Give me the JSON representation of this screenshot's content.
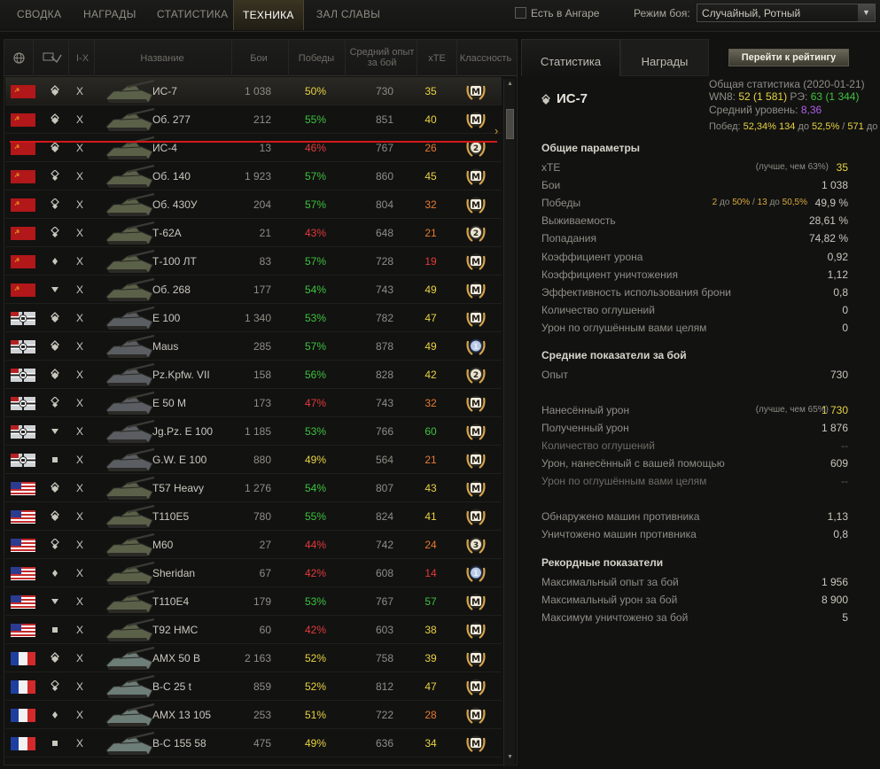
{
  "tabs": [
    "СВОДКА",
    "НАГРАДЫ",
    "СТАТИСТИКА",
    "ТЕХНИКА",
    "ЗАЛ СЛАВЫ"
  ],
  "hangar_label": "Есть в Ангаре",
  "mode_label": "Режим боя:",
  "mode_value": "Случайный, Ротный",
  "columns": {
    "tier": "I-X",
    "name": "Название",
    "battles": "Бои",
    "wins": "Победы",
    "avg_exp": "Средний опыт за бой",
    "xte": "хТЕ",
    "mastery": "Классность"
  },
  "rows": [
    {
      "nation": "ussr",
      "cls": "heavy",
      "tier": "X",
      "name": "ИС-7",
      "battles": "1 038",
      "wins": "50%",
      "wc": "y",
      "exp": "730",
      "xte": "35",
      "xc": "y",
      "mastery": "M",
      "sel": true
    },
    {
      "nation": "ussr",
      "cls": "heavy",
      "tier": "X",
      "name": "Об. 277",
      "battles": "212",
      "wins": "55%",
      "wc": "g",
      "exp": "851",
      "xte": "40",
      "xc": "y",
      "mastery": "M"
    },
    {
      "nation": "ussr",
      "cls": "heavy",
      "tier": "X",
      "name": "ИС-4",
      "battles": "13",
      "wins": "46%",
      "wc": "r",
      "exp": "767",
      "xte": "26",
      "xc": "o",
      "mastery": "2"
    },
    {
      "nation": "ussr",
      "cls": "medium",
      "tier": "X",
      "name": "Об. 140",
      "battles": "1 923",
      "wins": "57%",
      "wc": "g",
      "exp": "860",
      "xte": "45",
      "xc": "y",
      "mastery": "M"
    },
    {
      "nation": "ussr",
      "cls": "medium",
      "tier": "X",
      "name": "Об. 430У",
      "battles": "204",
      "wins": "57%",
      "wc": "g",
      "exp": "804",
      "xte": "32",
      "xc": "o",
      "mastery": "M"
    },
    {
      "nation": "ussr",
      "cls": "medium",
      "tier": "X",
      "name": "Т-62А",
      "battles": "21",
      "wins": "43%",
      "wc": "r",
      "exp": "648",
      "xte": "21",
      "xc": "o",
      "mastery": "2"
    },
    {
      "nation": "ussr",
      "cls": "light",
      "tier": "X",
      "name": "Т-100 ЛТ",
      "battles": "83",
      "wins": "57%",
      "wc": "g",
      "exp": "728",
      "xte": "19",
      "xc": "r",
      "mastery": "M"
    },
    {
      "nation": "ussr",
      "cls": "td",
      "tier": "X",
      "name": "Об. 268",
      "battles": "177",
      "wins": "54%",
      "wc": "g",
      "exp": "743",
      "xte": "49",
      "xc": "y",
      "mastery": "M"
    },
    {
      "nation": "germany",
      "cls": "heavy",
      "tier": "X",
      "name": "E 100",
      "battles": "1 340",
      "wins": "53%",
      "wc": "g",
      "exp": "782",
      "xte": "47",
      "xc": "y",
      "mastery": "M"
    },
    {
      "nation": "germany",
      "cls": "heavy",
      "tier": "X",
      "name": "Maus",
      "battles": "285",
      "wins": "57%",
      "wc": "g",
      "exp": "878",
      "xte": "49",
      "xc": "y",
      "mastery": "1"
    },
    {
      "nation": "germany",
      "cls": "heavy",
      "tier": "X",
      "name": "Pz.Kpfw. VII",
      "battles": "158",
      "wins": "56%",
      "wc": "g",
      "exp": "828",
      "xte": "42",
      "xc": "y",
      "mastery": "2"
    },
    {
      "nation": "germany",
      "cls": "medium",
      "tier": "X",
      "name": "E 50 M",
      "battles": "173",
      "wins": "47%",
      "wc": "r",
      "exp": "743",
      "xte": "32",
      "xc": "o",
      "mastery": "M"
    },
    {
      "nation": "germany",
      "cls": "td",
      "tier": "X",
      "name": "Jg.Pz. E 100",
      "battles": "1 185",
      "wins": "53%",
      "wc": "g",
      "exp": "766",
      "xte": "60",
      "xc": "g",
      "mastery": "M"
    },
    {
      "nation": "germany",
      "cls": "spg",
      "tier": "X",
      "name": "G.W. E 100",
      "battles": "880",
      "wins": "49%",
      "wc": "y",
      "exp": "564",
      "xte": "21",
      "xc": "o",
      "mastery": "M"
    },
    {
      "nation": "usa",
      "cls": "heavy",
      "tier": "X",
      "name": "T57 Heavy",
      "battles": "1 276",
      "wins": "54%",
      "wc": "g",
      "exp": "807",
      "xte": "43",
      "xc": "y",
      "mastery": "M"
    },
    {
      "nation": "usa",
      "cls": "heavy",
      "tier": "X",
      "name": "T110E5",
      "battles": "780",
      "wins": "55%",
      "wc": "g",
      "exp": "824",
      "xte": "41",
      "xc": "y",
      "mastery": "M"
    },
    {
      "nation": "usa",
      "cls": "medium",
      "tier": "X",
      "name": "M60",
      "battles": "27",
      "wins": "44%",
      "wc": "r",
      "exp": "742",
      "xte": "24",
      "xc": "o",
      "mastery": "3",
      "gold": true
    },
    {
      "nation": "usa",
      "cls": "light",
      "tier": "X",
      "name": "Sheridan",
      "battles": "67",
      "wins": "42%",
      "wc": "r",
      "exp": "608",
      "xte": "14",
      "xc": "r",
      "mastery": "1"
    },
    {
      "nation": "usa",
      "cls": "td",
      "tier": "X",
      "name": "T110E4",
      "battles": "179",
      "wins": "53%",
      "wc": "g",
      "exp": "767",
      "xte": "57",
      "xc": "g",
      "mastery": "M"
    },
    {
      "nation": "usa",
      "cls": "spg",
      "tier": "X",
      "name": "T92 HMC",
      "battles": "60",
      "wins": "42%",
      "wc": "r",
      "exp": "603",
      "xte": "38",
      "xc": "y",
      "mastery": "M"
    },
    {
      "nation": "france",
      "cls": "heavy",
      "tier": "X",
      "name": "AMX 50 B",
      "battles": "2 163",
      "wins": "52%",
      "wc": "y",
      "exp": "758",
      "xte": "39",
      "xc": "y",
      "mastery": "M"
    },
    {
      "nation": "france",
      "cls": "medium",
      "tier": "X",
      "name": "B-C 25 t",
      "battles": "859",
      "wins": "52%",
      "wc": "y",
      "exp": "812",
      "xte": "47",
      "xc": "y",
      "mastery": "M"
    },
    {
      "nation": "france",
      "cls": "light",
      "tier": "X",
      "name": "AMX 13 105",
      "battles": "253",
      "wins": "51%",
      "wc": "y",
      "exp": "722",
      "xte": "28",
      "xc": "o",
      "mastery": "M"
    },
    {
      "nation": "france",
      "cls": "spg",
      "tier": "X",
      "name": "B-C 155 58",
      "battles": "475",
      "wins": "49%",
      "wc": "y",
      "exp": "636",
      "xte": "34",
      "xc": "y",
      "mastery": "M"
    }
  ],
  "right": {
    "tab_stats": "Статистика",
    "tab_awards": "Награды",
    "rating_button": "Перейти к рейтингу",
    "vehicle_name": "ИС-7",
    "overall_date": "Общая статистика (2020-01-21)",
    "wn8_label": "WN8:",
    "wn8_value": "52",
    "wn8_extra": "(1 581)",
    "re_label": "РЭ:",
    "re_value": "63",
    "re_extra": "(1 344)",
    "avg_level_label": "Средний уровень:",
    "avg_level": "8,36",
    "wins_label": "Побед:",
    "wins_pct": "52,34%",
    "wins_mid1": "134",
    "wins_mid2": "до",
    "wins_mid3": "52,5%",
    "wins_sep": "/",
    "wins_end1": "571",
    "wins_end2": "до",
    "general_title": "Общие параметры",
    "avg_title": "Средние показатели за бой",
    "record_title": "Рекордные показатели",
    "general": [
      {
        "label": "хТЕ",
        "value": "35",
        "vc": "y",
        "note": "(лучше, чем 63%)"
      },
      {
        "label": "Бои",
        "value": "1 038"
      },
      {
        "label": "Победы",
        "value": "49,9 %",
        "note_wins": true
      },
      {
        "label": "Выживаемость",
        "value": "28,61 %"
      },
      {
        "label": "Попадания",
        "value": "74,82 %"
      },
      {
        "label": "Коэффициент урона",
        "value": "0,92"
      },
      {
        "label": "Коэффициент уничтожения",
        "value": "1,12"
      },
      {
        "label": "Эффективность использования брони",
        "value": "0,8"
      },
      {
        "label": "Количество оглушений",
        "value": "0"
      },
      {
        "label": "Урон по оглушённым вами целям",
        "value": "0"
      }
    ],
    "wins_note": {
      "a": "2",
      "b": "до",
      "c": "50%",
      "d": "/",
      "e": "13",
      "f": "до",
      "g": "50,5%"
    },
    "avg": [
      {
        "label": "Опыт",
        "value": "730"
      },
      {
        "label": "Нанесённый урон",
        "value": "1 730",
        "vc": "y",
        "note": "(лучше, чем 65%)"
      },
      {
        "label": "Полученный урон",
        "value": "1 876"
      },
      {
        "label": "Количество оглушений",
        "value": "--",
        "dim": true
      },
      {
        "label": "Урон, нанесённый с вашей помощью",
        "value": "609"
      },
      {
        "label": "Урон по оглушённым вами целям",
        "value": "--",
        "dim": true
      },
      {
        "label": "Обнаружено машин противника",
        "value": "1,13"
      },
      {
        "label": "Уничтожено машин противника",
        "value": "0,8"
      }
    ],
    "records": [
      {
        "label": "Максимальный опыт за бой",
        "value": "1 956"
      },
      {
        "label": "Максимальный урон за бой",
        "value": "8 900"
      },
      {
        "label": "Максимум уничтожено за бой",
        "value": "5"
      }
    ]
  }
}
